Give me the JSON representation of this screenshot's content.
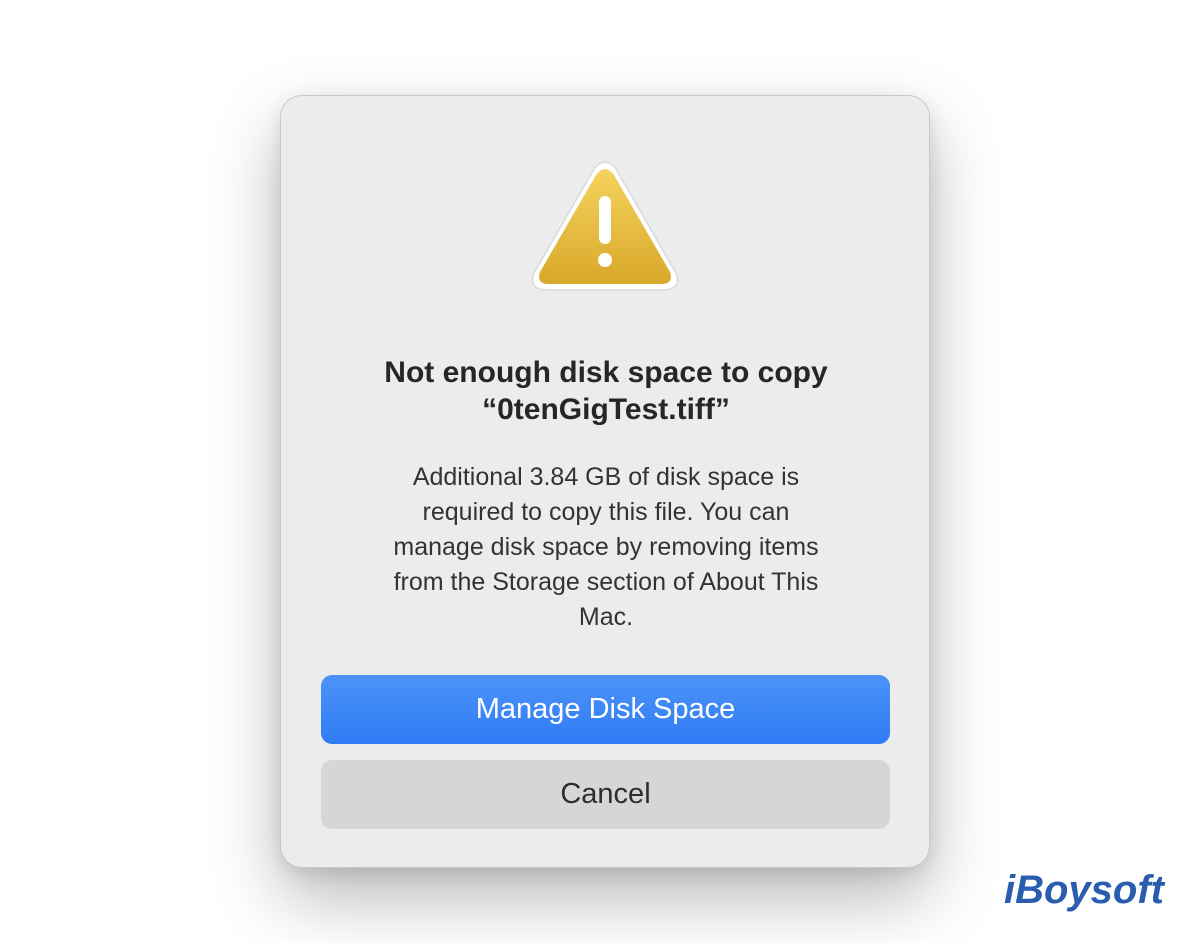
{
  "dialog": {
    "icon": "warning-triangle-icon",
    "title_lines": [
      "Not enough disk space to copy",
      "“0tenGigTest.tiff”"
    ],
    "message_lines": [
      "Additional 3.84 GB of disk space is",
      "required to copy this file. You can",
      "manage disk space by removing items",
      "from the Storage section of About This",
      "Mac."
    ],
    "primary_button_label": "Manage Disk Space",
    "cancel_button_label": "Cancel"
  },
  "watermark": {
    "text": "iBoysoft"
  },
  "colors": {
    "primary_button": "#2f7cf5",
    "warning_icon": "#e7b83a",
    "dialog_background": "#ececec"
  }
}
